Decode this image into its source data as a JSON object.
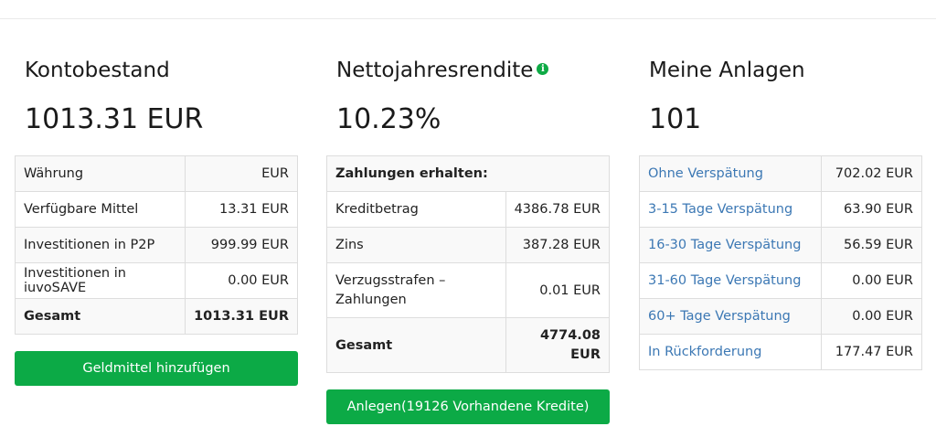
{
  "kontobestand": {
    "title": "Kontobestand",
    "value": "1013.31 EUR",
    "rows": [
      {
        "label": "Währung",
        "value": "EUR"
      },
      {
        "label": "Verfügbare Mittel",
        "value": "13.31 EUR"
      },
      {
        "label": "Investitionen in P2P",
        "value": "999.99 EUR"
      },
      {
        "label": "Investitionen in iuvoSAVE",
        "value": "0.00 EUR"
      },
      {
        "label": "Gesamt",
        "value": "1013.31 EUR"
      }
    ],
    "button_label": "Geldmittel hinzufügen"
  },
  "rendite": {
    "title": "Nettojahresrendite",
    "info_icon": "i",
    "value": "10.23%",
    "header_row": "Zahlungen erhalten:",
    "rows": [
      {
        "label": "Kreditbetrag",
        "value": "4386.78 EUR"
      },
      {
        "label": "Zins",
        "value": "387.28 EUR"
      },
      {
        "label": "Verzugsstrafen – Zahlungen",
        "value": "0.01 EUR"
      },
      {
        "label": "Gesamt",
        "value": "4774.08 EUR"
      }
    ],
    "button_label": "Anlegen(19126 Vorhandene Kredite)"
  },
  "anlagen": {
    "title": "Meine Anlagen",
    "value": "101",
    "rows": [
      {
        "label": "Ohne Verspätung",
        "value": "702.02 EUR"
      },
      {
        "label": "3-15 Tage Verspätung",
        "value": "63.90 EUR"
      },
      {
        "label": "16-30 Tage Verspätung",
        "value": "56.59 EUR"
      },
      {
        "label": "31-60 Tage Verspätung",
        "value": "0.00 EUR"
      },
      {
        "label": "60+ Tage Verspätung",
        "value": "0.00 EUR"
      },
      {
        "label": "In Rückforderung",
        "value": "177.47 EUR"
      }
    ]
  },
  "colors": {
    "accent_green": "#0caa46",
    "link_blue": "#3c78b4"
  }
}
